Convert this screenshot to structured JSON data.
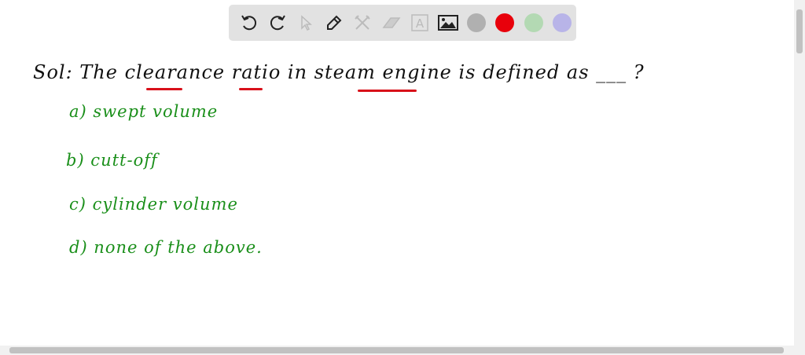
{
  "toolbar": {
    "tools": [
      "undo-icon",
      "redo-icon",
      "select-icon",
      "pen-icon",
      "tools-icon",
      "eraser-icon",
      "text-icon",
      "image-icon"
    ],
    "colors": [
      "#b0b0b0",
      "#e8000b",
      "#b3d9b3",
      "#b8b4e8"
    ]
  },
  "note": {
    "question": "Sol: The clearance ratio in steam engine is defined as ___ ?",
    "options": [
      "a) swept volume",
      "b) cutt-off",
      "c) cylinder volume",
      "d) none of the above."
    ]
  }
}
